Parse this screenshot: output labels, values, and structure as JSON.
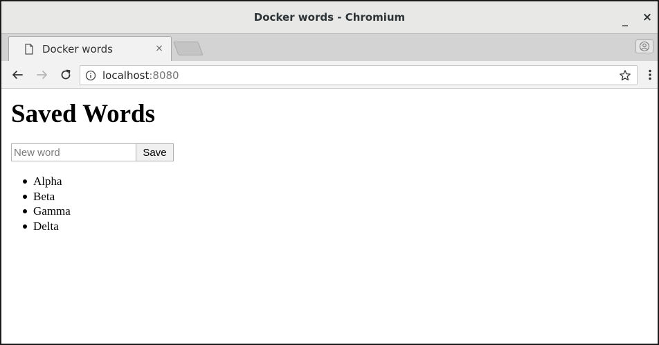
{
  "window": {
    "title": "Docker words - Chromium",
    "minimize_glyph": "_",
    "close_glyph": "×"
  },
  "tabs": [
    {
      "title": "Docker words",
      "icon": "page-icon",
      "close_glyph": "×"
    }
  ],
  "toolbar": {
    "back_icon": "back-arrow-icon",
    "forward_icon": "forward-arrow-icon",
    "reload_icon": "reload-icon",
    "info_icon": "info-icon",
    "bookmark_icon": "star-icon",
    "menu_icon": "kebab-menu-icon"
  },
  "address": {
    "host": "localhost",
    "port": ":8080"
  },
  "page": {
    "heading": "Saved Words",
    "input_placeholder": "New word",
    "input_value": "",
    "save_label": "Save",
    "words": [
      "Alpha",
      "Beta",
      "Gamma",
      "Delta"
    ]
  },
  "colors": {
    "titlebar_bg": "#e8e8e7",
    "tabstrip_bg": "#d3d3d3",
    "toolbar_bg": "#f2f2f2",
    "window_border": "#1a1a1a"
  }
}
